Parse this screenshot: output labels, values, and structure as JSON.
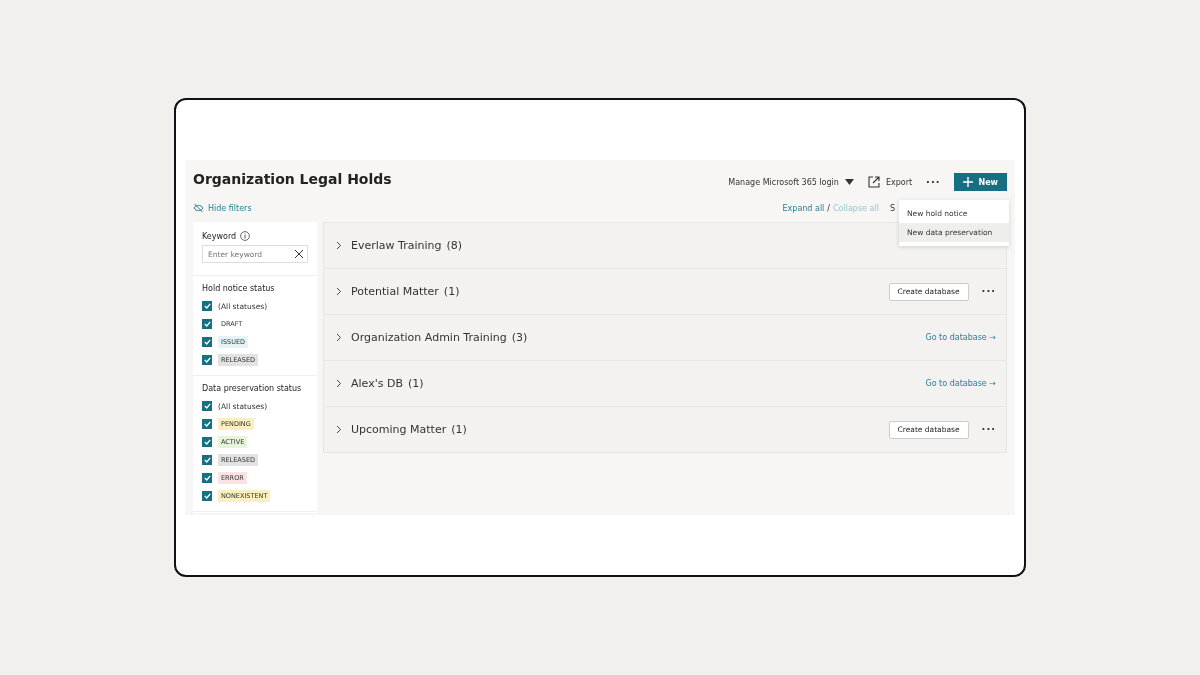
{
  "header": {
    "title": "Organization Legal Holds",
    "login_menu": "Manage Microsoft 365 login",
    "export": "Export",
    "more": "···",
    "new_button": "New"
  },
  "new_menu": {
    "items": [
      {
        "label": "New hold notice",
        "selected": false
      },
      {
        "label": "New data preservation",
        "selected": true
      }
    ]
  },
  "hide_filters": "Hide filters",
  "expand_all": "Expand all",
  "separator": "/",
  "collapse_all": "Collapse all",
  "cut_label": "S",
  "filters": {
    "keyword": {
      "label": "Keyword",
      "placeholder": "Enter keyword"
    },
    "groups": [
      {
        "title": "Hold notice status",
        "options": [
          {
            "label": "(All statuses)",
            "kind": "option",
            "checked": true
          },
          {
            "label": "DRAFT",
            "kind": "tag",
            "checked": true
          },
          {
            "label": "ISSUED",
            "kind": "tag",
            "checked": true,
            "color": "#e3f3f8"
          },
          {
            "label": "RELEASED",
            "kind": "tag",
            "checked": true,
            "color": "#e2e2e2"
          }
        ]
      },
      {
        "title": "Data preservation status",
        "options": [
          {
            "label": "(All statuses)",
            "kind": "option",
            "checked": true
          },
          {
            "label": "PENDING",
            "kind": "tag",
            "checked": true,
            "color": "#fbeec2"
          },
          {
            "label": "ACTIVE",
            "kind": "tag",
            "checked": true,
            "color": "#e6f4d7"
          },
          {
            "label": "RELEASED",
            "kind": "tag",
            "checked": true,
            "color": "#e2e2e2"
          },
          {
            "label": "ERROR",
            "kind": "tag",
            "checked": true,
            "color": "#fbe3e3"
          },
          {
            "label": "NONEXISTENT",
            "kind": "tag",
            "checked": true,
            "color": "#fbeec2"
          }
        ]
      }
    ]
  },
  "matters": [
    {
      "name": "Everlaw Training",
      "count": "(8)",
      "expanded": false
    },
    {
      "name": "Potential Matter",
      "count": "(1)",
      "expanded": false,
      "action": {
        "kind": "button",
        "label": "Create database"
      },
      "more": "···"
    },
    {
      "name": "Organization Admin Training",
      "count": "(3)",
      "expanded": false,
      "action": {
        "kind": "link",
        "label": "Go to database →"
      }
    },
    {
      "name": "Alex's DB",
      "count": "(1)",
      "expanded": false,
      "action": {
        "kind": "link",
        "label": "Go to database →"
      }
    },
    {
      "name": "Upcoming Matter",
      "count": "(1)",
      "expanded": false,
      "action": {
        "kind": "button",
        "label": "Create database"
      },
      "more": "···"
    }
  ]
}
